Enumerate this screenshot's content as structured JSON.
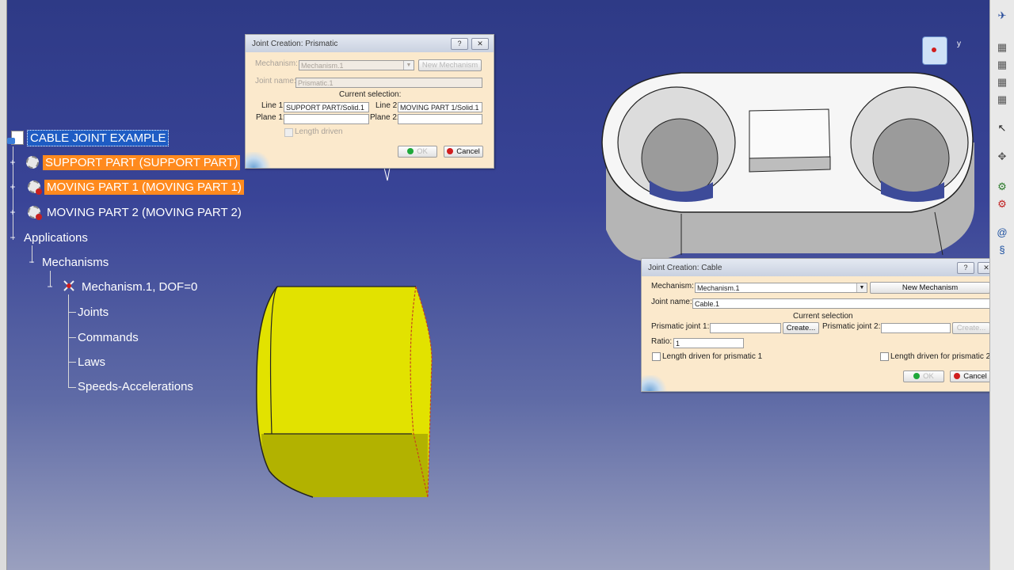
{
  "tree": {
    "root": "CABLE JOINT EXAMPLE",
    "support_part": "SUPPORT PART (SUPPORT PART)",
    "moving_part_1": "MOVING PART 1 (MOVING PART 1)",
    "moving_part_2": "MOVING PART 2 (MOVING PART 2)",
    "applications": "Applications",
    "mechanisms": "Mechanisms",
    "mechanism1": "Mechanism.1, DOF=0",
    "joints": "Joints",
    "commands": "Commands",
    "laws": "Laws",
    "speeds": "Speeds-Accelerations"
  },
  "prismatic_dialog": {
    "title": "Joint Creation: Prismatic",
    "help_btn": "?",
    "close_btn": "✕",
    "mechanism_label": "Mechanism:",
    "mechanism_value": "Mechanism.1",
    "new_mechanism": "New Mechanism",
    "joint_name_label": "Joint name:",
    "joint_name_value": "Prismatic.1",
    "current_selection": "Current selection:",
    "line1_label": "Line 1:",
    "line1_value": "SUPPORT PART/Solid.1",
    "line2_label": "Line 2:",
    "line2_value": "MOVING PART 1/Solid.1",
    "plane1_label": "Plane 1:",
    "plane2_label": "Plane 2:",
    "length_driven": "Length driven",
    "ok": "OK",
    "cancel": "Cancel"
  },
  "cable_dialog": {
    "title": "Joint Creation: Cable",
    "help_btn": "?",
    "close_btn": "✕",
    "mechanism_label": "Mechanism:",
    "mechanism_value": "Mechanism.1",
    "new_mechanism": "New Mechanism",
    "joint_name_label": "Joint name:",
    "joint_name_value": "Cable.1",
    "current_selection": "Current selection",
    "prismatic1_label": "Prismatic joint 1:",
    "create1": "Create...",
    "prismatic2_label": "Prismatic joint 2:",
    "create2": "Create...",
    "ratio_label": "Ratio:",
    "ratio_value": "1",
    "len_driven_1": "Length driven for prismatic 1",
    "len_driven_2": "Length driven for prismatic 2",
    "ok": "OK",
    "cancel": "Cancel"
  },
  "compass": {
    "axis_label": "y"
  },
  "colors": {
    "selection_blue": "#1e5cc4",
    "selection_orange": "#ff8a1e",
    "part_yellow": "#e6e600",
    "dialog_bg": "#fbe9cc"
  }
}
